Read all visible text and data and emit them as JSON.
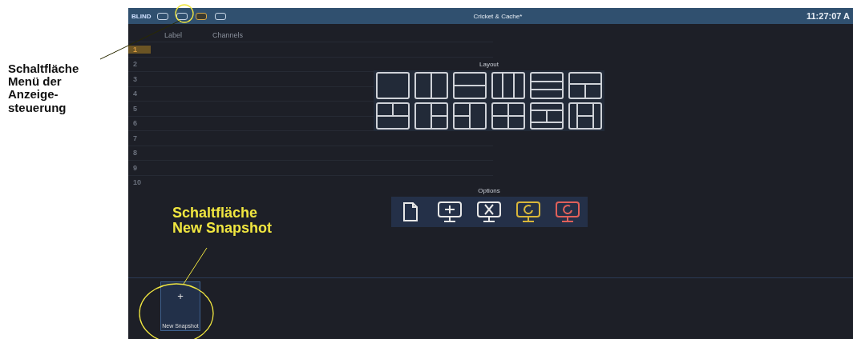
{
  "annotations": [
    {
      "text": "Schaltfläche\nMenü der\nAnzeige-\nsteuerung",
      "color": "#111111"
    },
    {
      "text": "Schaltfläche\nNew Snapshot",
      "color": "#f0e640"
    }
  ],
  "topbar": {
    "mode": "BLIND",
    "view_buttons": [
      {
        "selected": false
      },
      {
        "selected": false
      },
      {
        "selected": true
      },
      {
        "selected": false
      }
    ],
    "title": "Cricket & Cache*",
    "clock": "11:27:07 A"
  },
  "table": {
    "columns": [
      "Label",
      "Channels"
    ],
    "rows": [
      {
        "number": "1",
        "selected": true
      },
      {
        "number": "2",
        "selected": false
      },
      {
        "number": "3",
        "selected": false
      },
      {
        "number": "4",
        "selected": false
      },
      {
        "number": "5",
        "selected": false
      },
      {
        "number": "6",
        "selected": false
      },
      {
        "number": "7",
        "selected": false
      },
      {
        "number": "8",
        "selected": false
      },
      {
        "number": "9",
        "selected": false
      },
      {
        "number": "10",
        "selected": false
      }
    ]
  },
  "popup": {
    "layout_title": "Layout",
    "layouts": [
      {
        "kind": "full"
      },
      {
        "kind": "cols2"
      },
      {
        "kind": "rows2"
      },
      {
        "kind": "cols3"
      },
      {
        "kind": "rows3"
      },
      {
        "kind": "top-split-bottom"
      },
      {
        "kind": "split-top"
      },
      {
        "kind": "left-splitright"
      },
      {
        "kind": "splitleft-right"
      },
      {
        "kind": "quad"
      },
      {
        "kind": "mid-split-row"
      },
      {
        "kind": "mid-split-col"
      }
    ],
    "options_title": "Options",
    "options": [
      {
        "kind": "page",
        "color": "#e8e8e8"
      },
      {
        "kind": "add",
        "color": "#e8e8e8"
      },
      {
        "kind": "remove",
        "color": "#e8e8e8"
      },
      {
        "kind": "refresh",
        "color": "#d8b63a"
      },
      {
        "kind": "snapshot",
        "color": "#e0605a"
      }
    ]
  },
  "snapshots": {
    "plus": "+",
    "new_label": "New Snapshot"
  }
}
